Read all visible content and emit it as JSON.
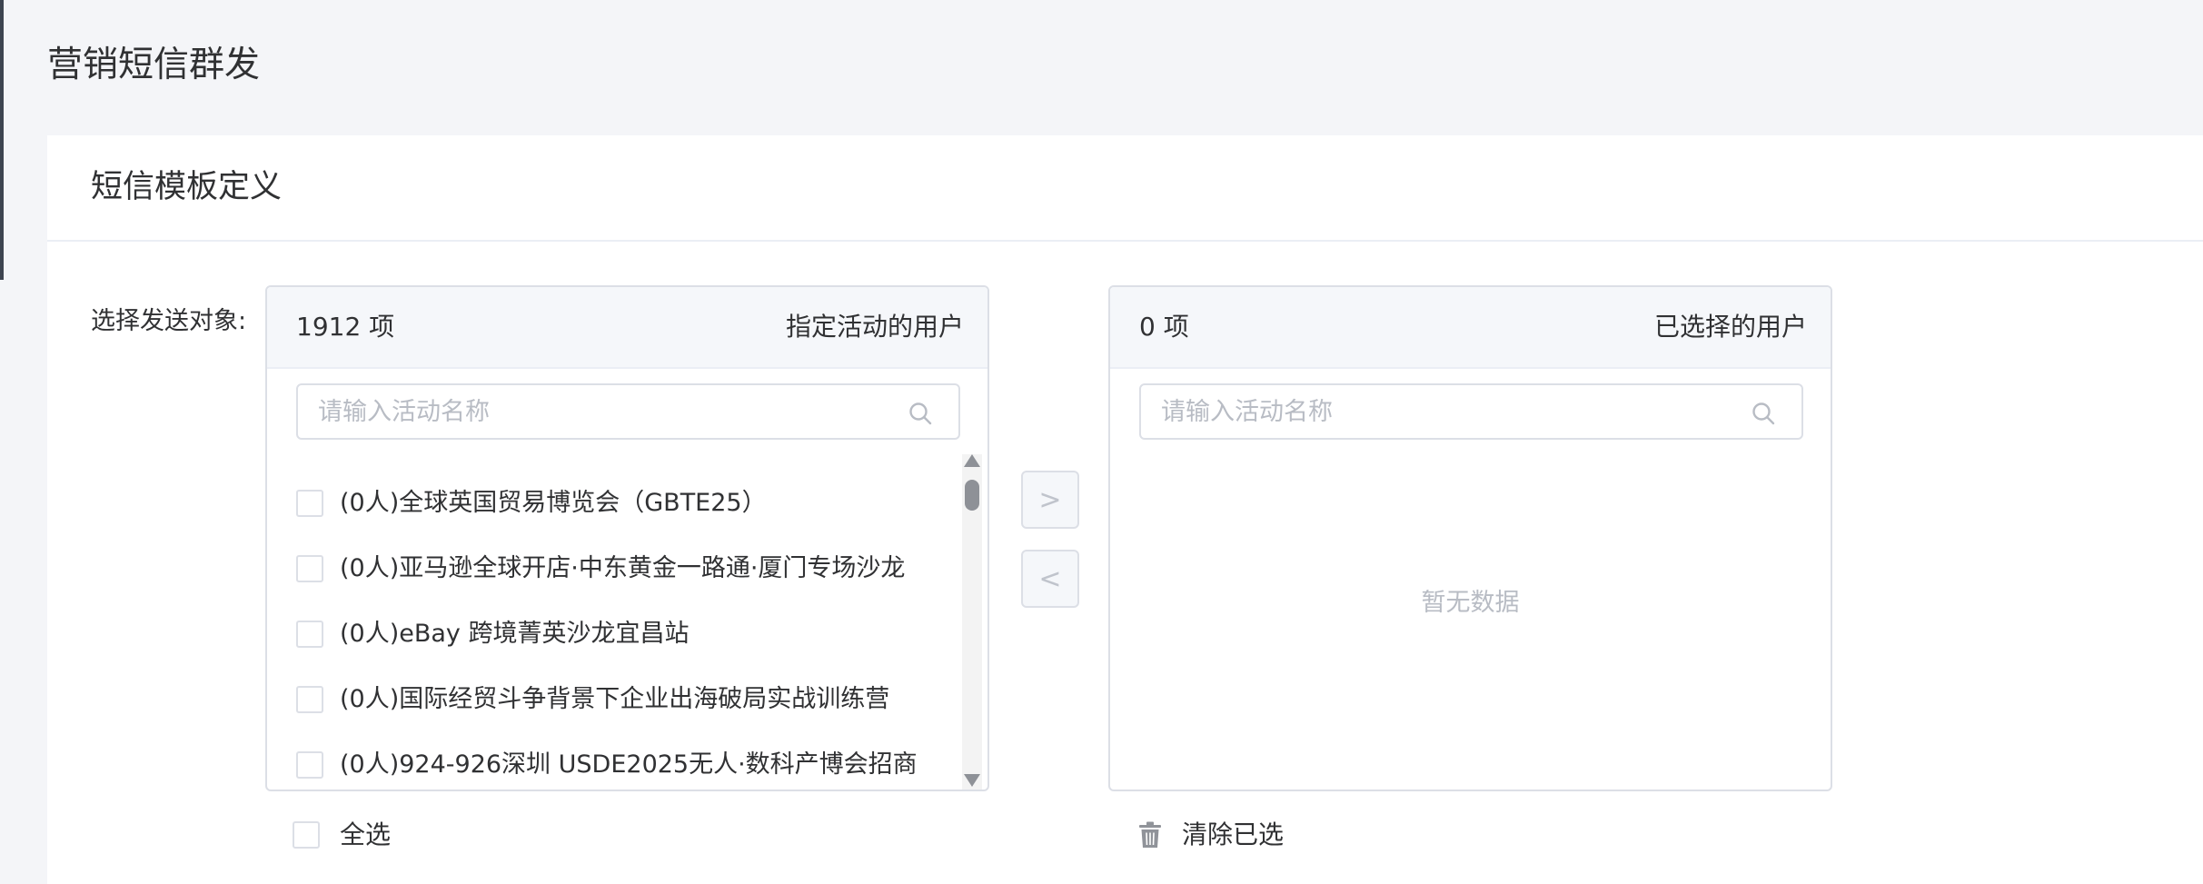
{
  "page": {
    "title": "营销短信群发"
  },
  "card": {
    "title": "短信模板定义"
  },
  "form": {
    "target_label": "选择发送对象:"
  },
  "left_panel": {
    "count": "1912 项",
    "title": "指定活动的用户",
    "search_placeholder": "请输入活动名称",
    "items": [
      {
        "label": "(0人)全球英国贸易博览会（GBTE25）",
        "checked": false
      },
      {
        "label": "(0人)亚马逊全球开店·中东黄金一路通·厦门专场沙龙",
        "checked": false
      },
      {
        "label": "(0人)eBay 跨境菁英沙龙宜昌站",
        "checked": false
      },
      {
        "label": "(0人)国际经贸斗争背景下企业出海破局实战训练营",
        "checked": false
      },
      {
        "label": "(0人)924-926深圳 USDE2025无人·数科产博会招商",
        "checked": false
      }
    ],
    "select_all_label": "全选"
  },
  "transfer": {
    "to_right_symbol": ">",
    "to_left_symbol": "<"
  },
  "right_panel": {
    "count": "0 项",
    "title": "已选择的用户",
    "search_placeholder": "请输入活动名称",
    "empty_text": "暂无数据",
    "clear_label": "清除已选"
  },
  "colors": {
    "page_bg": "#f4f5f8",
    "card_bg": "#ffffff",
    "border": "#dcdfe6",
    "header_bg": "#f5f7fa",
    "text": "#303133",
    "placeholder": "#b8bcc4",
    "disabled": "#c0c4cc"
  },
  "icons": {
    "search": "search-icon",
    "trash": "trash-icon",
    "scroll_up": "triangle-up-icon",
    "scroll_down": "triangle-down-icon"
  }
}
